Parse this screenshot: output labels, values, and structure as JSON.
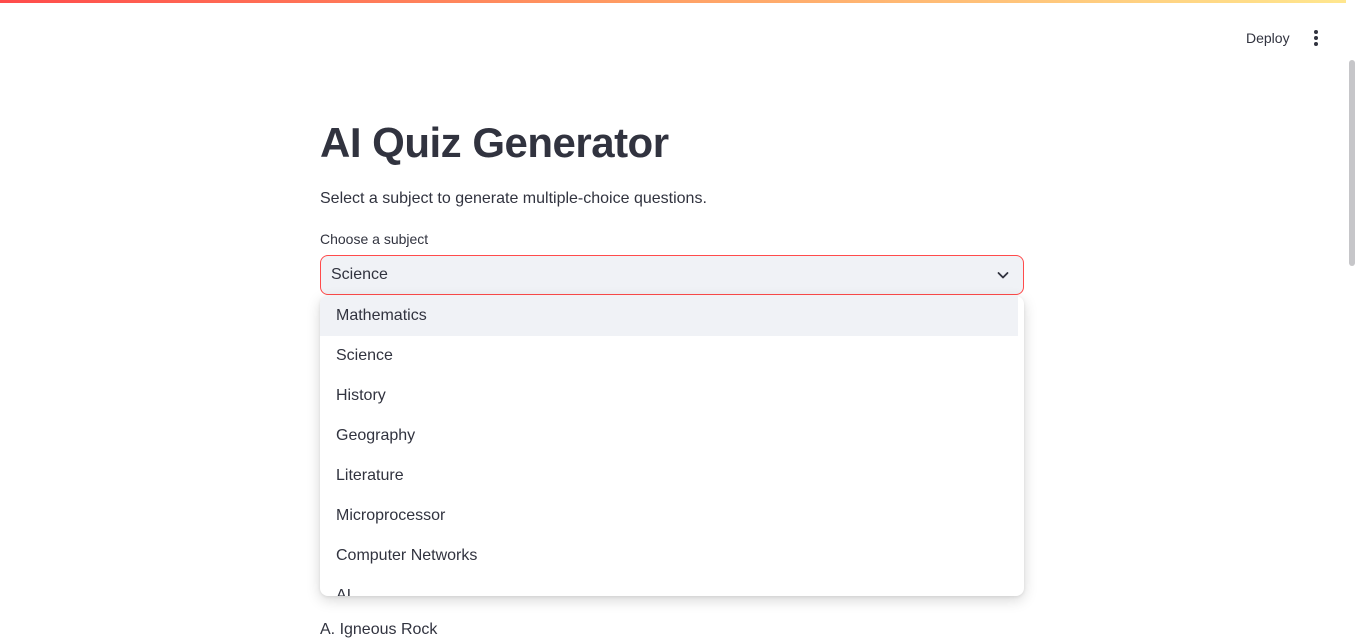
{
  "header": {
    "deploy_label": "Deploy",
    "menu_icon": "more-vertical-icon"
  },
  "main": {
    "title": "AI Quiz Generator",
    "subtitle": "Select a subject to generate multiple-choice questions.",
    "select": {
      "label": "Choose a subject",
      "value": "Science",
      "icon": "chevron-down-icon",
      "options": [
        {
          "label": "Mathematics"
        },
        {
          "label": "Science"
        },
        {
          "label": "History"
        },
        {
          "label": "Geography"
        },
        {
          "label": "Literature"
        },
        {
          "label": "Microprocessor"
        },
        {
          "label": "Computer Networks"
        },
        {
          "label": "AI"
        }
      ]
    },
    "answer_option": "A. Igneous Rock"
  },
  "colors": {
    "accent": "#ff4b4b",
    "text": "#31333f",
    "input_bg": "#f0f2f6"
  }
}
